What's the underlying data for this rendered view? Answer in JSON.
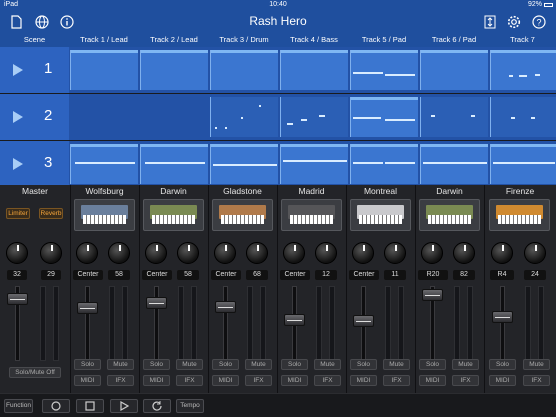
{
  "status": {
    "carrier": "iPad",
    "time": "10:40",
    "battery": "92%"
  },
  "nav": {
    "title": "Rash Hero"
  },
  "header": {
    "scene_label": "Scene",
    "tracks": [
      "Track 1 / Lead",
      "Track 2 / Lead",
      "Track 3 / Drum",
      "Track 4 / Bass",
      "Track 5 / Pad",
      "Track 6 / Pad",
      "Track 7"
    ]
  },
  "scenes": [
    {
      "number": "1"
    },
    {
      "number": "2"
    },
    {
      "number": "3"
    }
  ],
  "mixer": {
    "master": {
      "name": "Master",
      "limiter": "Limiter",
      "reverb": "Reverb",
      "knob1": "32",
      "knob2": "29",
      "solo_mute_off": "Solo/Mute Off"
    },
    "channels": [
      {
        "name": "Wolfsburg",
        "pan": "Center",
        "vol": "58",
        "solo": "Solo",
        "mute": "Mute",
        "midi": "MIDI",
        "ifx": "IFX",
        "color": "#6a7f9c"
      },
      {
        "name": "Darwin",
        "pan": "Center",
        "vol": "58",
        "solo": "Solo",
        "mute": "Mute",
        "midi": "MIDI",
        "ifx": "IFX",
        "color": "#7a8a52"
      },
      {
        "name": "Gladstone",
        "pan": "Center",
        "vol": "68",
        "solo": "Solo",
        "mute": "Mute",
        "midi": "MIDI",
        "ifx": "IFX",
        "color": "#b07a4a"
      },
      {
        "name": "Madrid",
        "pan": "Center",
        "vol": "12",
        "solo": "Solo",
        "mute": "Mute",
        "midi": "MIDI",
        "ifx": "IFX",
        "color": "#555558"
      },
      {
        "name": "Montreal",
        "pan": "Center",
        "vol": "11",
        "solo": "Solo",
        "mute": "Mute",
        "midi": "MIDI",
        "ifx": "IFX",
        "color": "#c9c9cc"
      },
      {
        "name": "Darwin",
        "pan": "R20",
        "vol": "82",
        "solo": "Solo",
        "mute": "Mute",
        "midi": "MIDI",
        "ifx": "IFX",
        "color": "#7a8a52"
      },
      {
        "name": "Firenze",
        "pan": "R4",
        "vol": "24",
        "solo": "Solo",
        "mute": "Mute",
        "midi": "MIDI",
        "ifx": "IFX",
        "color": "#d08a30"
      }
    ]
  },
  "toolbar": {
    "function": "Function",
    "tempo": "Tempo"
  },
  "colors": {
    "accent": "#1f4f9e",
    "scene": "#2352a6",
    "clip": "#3b76d0",
    "orange": "#f4a43a"
  }
}
